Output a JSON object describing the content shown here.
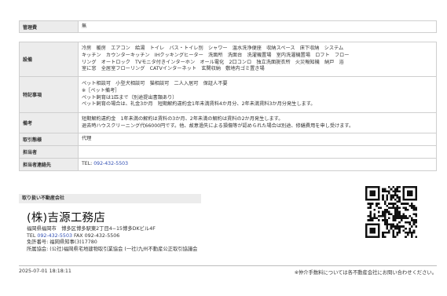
{
  "rows": {
    "management_fee": {
      "label": "管理費",
      "value": "無"
    },
    "facilities": {
      "label": "設備",
      "lines": [
        "冷房　暖房　エアコン　給湯　トイレ　バス・トイレ別　シャワー　温水洗浄便座　収納スペース　床下収納　システム",
        "キッチン　カウンターキッチン　IHクッキングヒーター　洗面所　洗面台　洗濯機置場　室内洗濯機置場　ロフト　フロー",
        "リング　オートロック　TVモニタ付きインターホン　オール電化　2口コンロ　独立洗面脱衣所　火災報知機　納戸　浴",
        "室に窓　全居室フローリング　CATVインターネット　玄関収納　敷地内ゴミ置き場"
      ]
    },
    "special_notes": {
      "label": "特記事項",
      "lines": [
        "ペット相談可　小型犬相談可　猫相談可　二人入居可　保証人不要",
        "※［ペット備考］",
        "ペット飼育は1匹まで（別途提出書類あり）",
        "ペット飼育の場合は、礼金3か月　短期解約違約金1年未満賃料4か月分、2年未満賃料3か月分発生します。"
      ]
    },
    "remarks": {
      "label": "備考",
      "lines": [
        "短期解約違約金　1年未満の解約は賃料の3か月、2年未満の解約は賃料の2か月発生します。",
        "退去時ハウスクリーニング代66000円です。他、故意過失による損傷等が認められた場合は別途、修繕費用を申し受けます。"
      ]
    },
    "transaction_type": {
      "label": "取引態様",
      "value": "代理"
    },
    "contact_person": {
      "label": "担当者",
      "value": ""
    },
    "contact_info": {
      "label": "担当者連絡先",
      "tel_prefix": "TEL: ",
      "tel": "092-432-5503"
    }
  },
  "agency": {
    "section_title": "取り扱い不動産会社",
    "name": "(株)吉源工務店",
    "address": "福岡県福岡市　博多区博多駅東2丁目4−15博多DKビル4F",
    "tel_label": "TEL ",
    "tel": "092-432-5503",
    "fax": " FAX 092-432-5506",
    "license": "免許番号: 福岡県知事(3)17780",
    "associations": "所属協会: (公社)福岡県宅地建物取引業協会 (一社)九州不動産公正取引協議会"
  },
  "footer": {
    "date": "2025-07-01 18:18:11",
    "note": "※仲介手数料については各不動産会社にお問い合わせください。"
  }
}
